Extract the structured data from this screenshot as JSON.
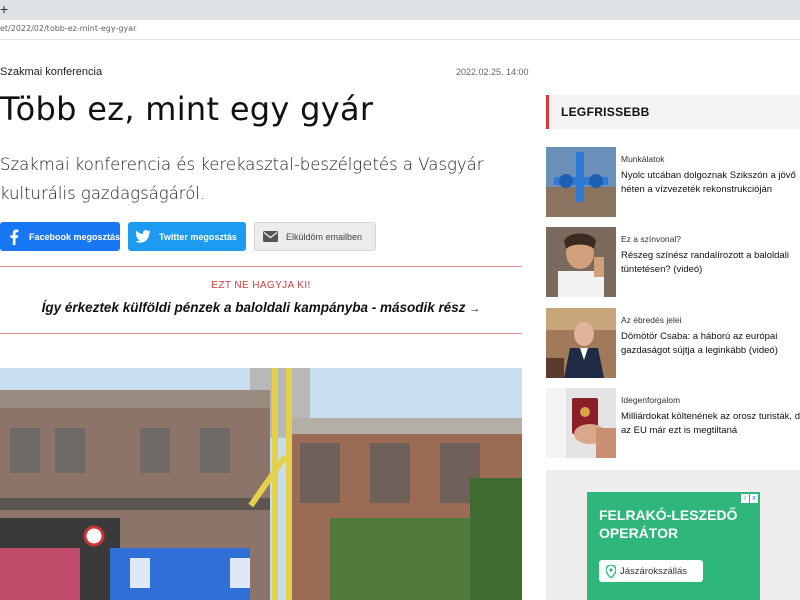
{
  "browser": {
    "new_tab": "+",
    "url": "et/2022/02/tobb-ez-mint-egy-gyar"
  },
  "article": {
    "category": "Szakmai konferencia",
    "date": "2022.02.25. 14:00",
    "title": "Több ez, mint egy gyár",
    "lead": "Szakmai konferencia és kerekasztal-beszélgetés a Vasgyár kulturális gazdagságáról",
    "lead_end": "."
  },
  "share": {
    "facebook": "Facebook megosztás",
    "twitter": "Twitter megosztás",
    "email": "Elküldöm emailben"
  },
  "promo": {
    "label": "EZT NE HAGYJA KI!",
    "link": "Így érkeztek külföldi pénzek a baloldali kampányba - második rész",
    "arrow": "→"
  },
  "sidebar": {
    "heading": "LEGFRISSEBB",
    "items": [
      {
        "category": "Munkálatok",
        "title": "Nyolc utcában dolgoznak Szikszón a jövő héten a vízvezeték rekonstrukcióján"
      },
      {
        "category": "Ez a színvonal?",
        "title": "Részeg színész randalírozott a baloldali tüntetésen? (videó)"
      },
      {
        "category": "Az ébredés jelei",
        "title": "Dömötör Csaba: a háború az európai gazdaságot sújtja a leginkább (videó)"
      },
      {
        "category": "Idegenforgalom",
        "title": "Milliárdokat költenének az orosz turisták, de az EU már ezt is megtiltaná"
      }
    ]
  },
  "ad": {
    "title": "FELRAKÓ-LESZEDŐ OPERÁTOR",
    "location": "Jászárokszállás",
    "close_left": "i",
    "close_right": "x"
  },
  "colors": {
    "accent": "#d6393d",
    "facebook": "#1877f2",
    "twitter": "#1d9bf0",
    "ad_green": "#2fb67a"
  }
}
